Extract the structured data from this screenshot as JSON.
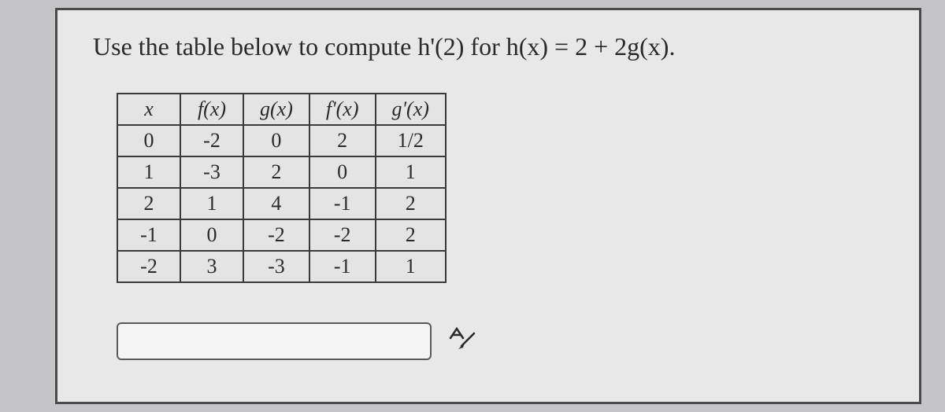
{
  "question": "Use the table below to compute h'(2) for h(x) = 2 + 2g(x).",
  "chart_data": {
    "type": "table",
    "columns": [
      "x",
      "f(x)",
      "g(x)",
      "f'(x)",
      "g'(x)"
    ],
    "rows": [
      {
        "x": "0",
        "fx": "-2",
        "gx": "0",
        "fpx": "2",
        "gpx": "1/2"
      },
      {
        "x": "1",
        "fx": "-3",
        "gx": "2",
        "fpx": "0",
        "gpx": "1"
      },
      {
        "x": "2",
        "fx": "1",
        "gx": "4",
        "fpx": "-1",
        "gpx": "2"
      },
      {
        "x": "-1",
        "fx": "0",
        "gx": "-2",
        "fpx": "-2",
        "gpx": "2"
      },
      {
        "x": "-2",
        "fx": "3",
        "gx": "-3",
        "fpx": "-1",
        "gpx": "1"
      }
    ]
  },
  "answer_value": "",
  "icon_label": "handwriting-input"
}
